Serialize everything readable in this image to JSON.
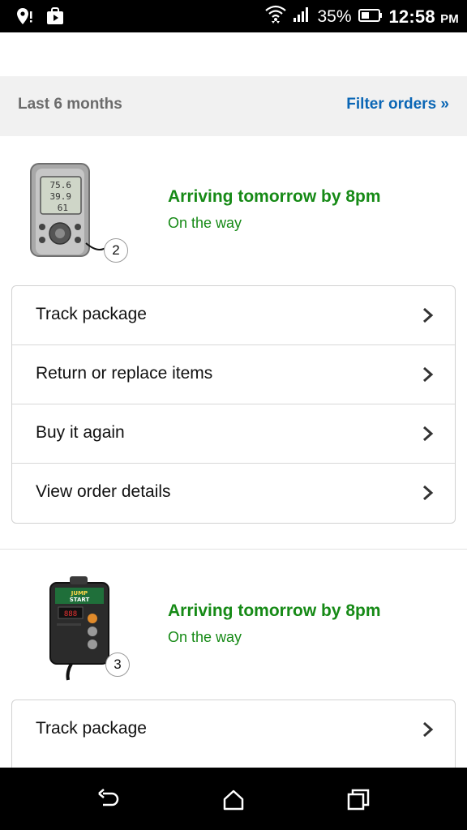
{
  "status_bar": {
    "battery_percent": "35%",
    "time": "12:58",
    "ampm": "PM",
    "icons": [
      "location-icon",
      "shopping-bag-icon",
      "wifi-icon",
      "signal-icon",
      "battery-icon"
    ]
  },
  "filter_bar": {
    "period_label": "Last 6 months",
    "filter_link": "Filter orders »"
  },
  "orders": [
    {
      "product_icon": "thermometer-hygrometer",
      "quantity": "2",
      "delivery_title": "Arriving tomorrow by 8pm",
      "delivery_status": "On the way",
      "actions": [
        {
          "label": "Track package"
        },
        {
          "label": "Return or replace items"
        },
        {
          "label": "Buy it again"
        },
        {
          "label": "View order details"
        }
      ]
    },
    {
      "product_icon": "thermostat-controller",
      "quantity": "3",
      "delivery_title": "Arriving tomorrow by 8pm",
      "delivery_status": "On the way",
      "actions": [
        {
          "label": "Track package"
        }
      ]
    }
  ],
  "nav_bar": {
    "buttons": [
      "back-icon",
      "home-icon",
      "recents-icon"
    ]
  },
  "colors": {
    "status_green": "#168a16",
    "link_blue": "#0a66b5",
    "filter_bg": "#f1f1f1"
  }
}
